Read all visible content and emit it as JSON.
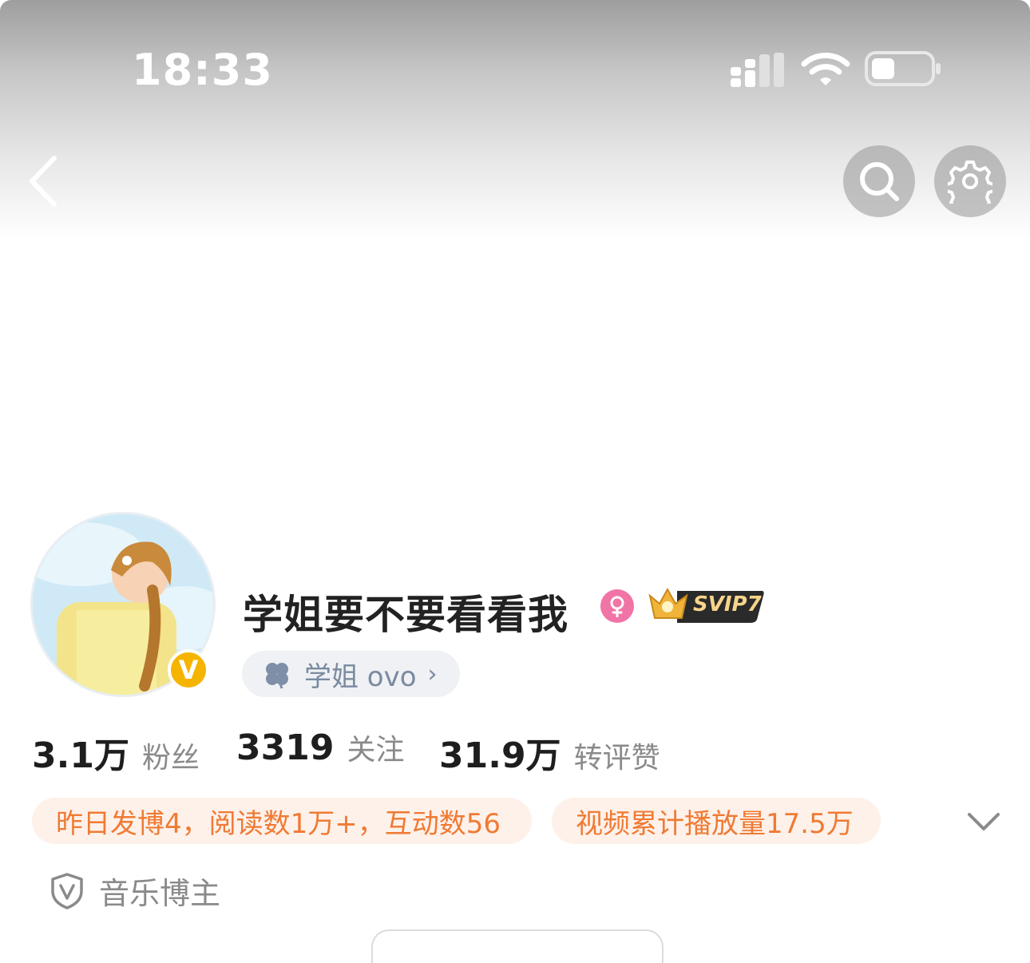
{
  "status_bar": {
    "time": "18:33"
  },
  "profile": {
    "name": "学姐要不要看看我",
    "nickname": "学姐 ovo",
    "svip": "SVIP7",
    "verified_mark": "V",
    "stats": [
      {
        "number": "3.1万",
        "label": "粉丝"
      },
      {
        "number": "3319",
        "label": "关注"
      },
      {
        "number": "31.9万",
        "label": "转评赞"
      }
    ],
    "tags": [
      "昨日发博4，阅读数1万+，互动数56",
      "视频累计播放量17.5万"
    ],
    "role": "音乐博主"
  },
  "icons": {
    "back": "back-chevron-icon",
    "search": "search-icon",
    "settings": "gear-icon",
    "gender": "female-icon",
    "expand": "chevron-down-icon",
    "role": "shield-v-icon"
  },
  "colors": {
    "accent_orange": "#f07a33",
    "tag_bg": "#fdf1ea",
    "verified_gold": "#f5b400",
    "gender_pink": "#f174a6"
  }
}
